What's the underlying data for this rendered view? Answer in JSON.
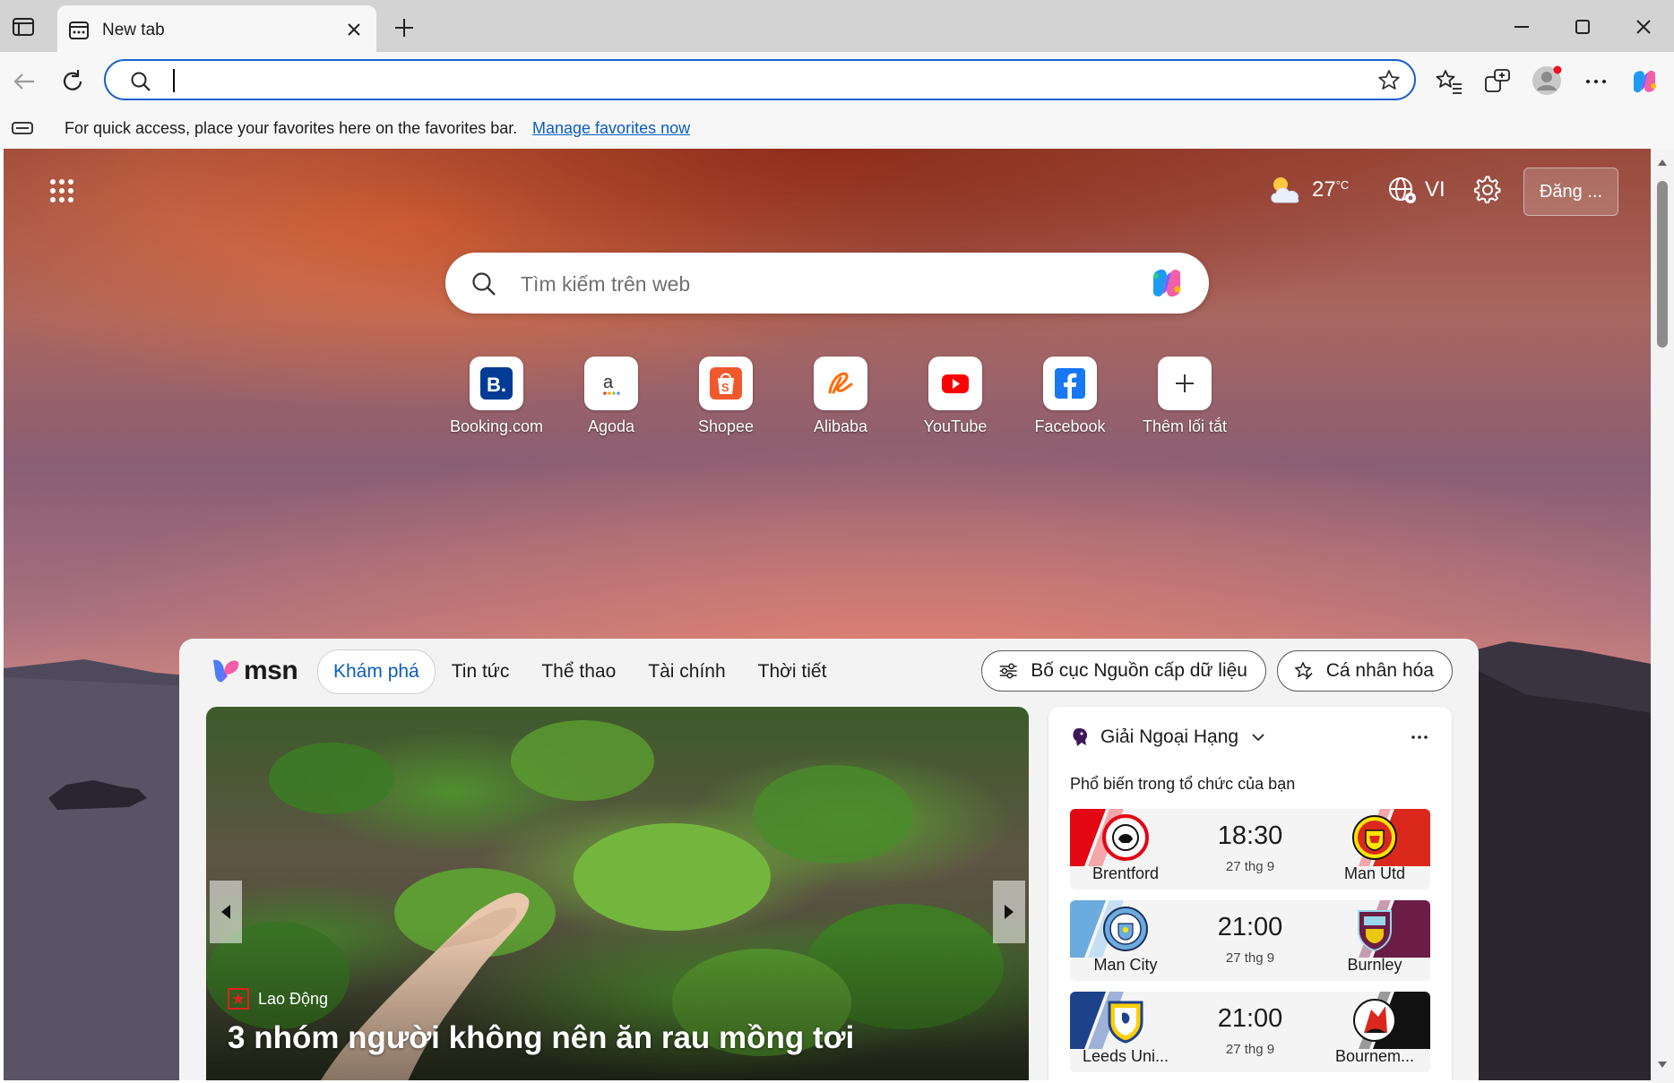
{
  "browser": {
    "tab": {
      "title": "New tab"
    },
    "omnibox": {
      "value": "",
      "placeholder": ""
    },
    "favorites_bar": {
      "message": "For quick access, place your favorites here on the favorites bar.",
      "link": "Manage favorites now"
    }
  },
  "newtab": {
    "weather": {
      "temp": "27",
      "unit": "°C"
    },
    "language": "VI",
    "signin_label": "Đăng ...",
    "search": {
      "placeholder": "Tìm kiếm trên web"
    },
    "shortcuts": [
      {
        "label": "Booking.com",
        "icon": "booking-icon"
      },
      {
        "label": "Agoda",
        "icon": "agoda-icon"
      },
      {
        "label": "Shopee",
        "icon": "shopee-icon"
      },
      {
        "label": "Alibaba",
        "icon": "alibaba-icon"
      },
      {
        "label": "YouTube",
        "icon": "youtube-icon"
      },
      {
        "label": "Facebook",
        "icon": "facebook-icon"
      },
      {
        "label": "Thêm lối tắt",
        "icon": "plus-icon"
      }
    ]
  },
  "feed": {
    "logo": "msn",
    "tabs": [
      "Khám phá",
      "Tin tức",
      "Thể thao",
      "Tài chính",
      "Thời tiết"
    ],
    "active_tab": "Khám phá",
    "layout_button": "Bố cục Nguồn cấp dữ liệu",
    "personalize_button": "Cá nhân hóa",
    "hero": {
      "source": "Lao Động",
      "headline": "3 nhóm người không nên ăn rau mồng tơi"
    },
    "sports": {
      "league": "Giải Ngoại Hạng",
      "subtitle": "Phổ biến trong tổ chức của bạn",
      "matches": [
        {
          "home": "Brentford",
          "away": "Man Utd",
          "time": "18:30",
          "date": "27 thg 9"
        },
        {
          "home": "Man City",
          "away": "Burnley",
          "time": "21:00",
          "date": "27 thg 9"
        },
        {
          "home": "Leeds Uni...",
          "away": "Bournem...",
          "time": "21:00",
          "date": "27 thg 9"
        }
      ]
    }
  },
  "colors": {
    "accent": "#0b5cc4",
    "omnibox_border": "#1a5fd0"
  }
}
